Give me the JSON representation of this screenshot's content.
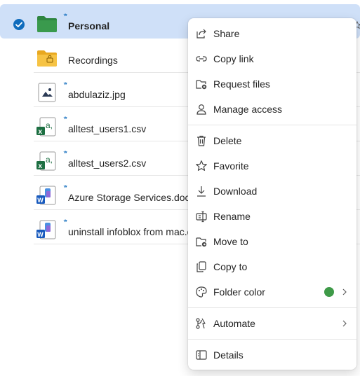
{
  "colors": {
    "selected_row_bg": "#cfe0f8",
    "accent": "#0f6cbd",
    "folder_green": "#2e8540",
    "folder_yellow": "#f6c344",
    "excel_green": "#1d6f42",
    "word_blue": "#185abd",
    "folder_color_swatch": "#3e9a48"
  },
  "files": [
    {
      "name": "Personal",
      "icon": "folder-green-icon",
      "selected": true
    },
    {
      "name": "Recordings",
      "icon": "folder-recordings-icon",
      "selected": false
    },
    {
      "name": "abdulaziz.jpg",
      "icon": "image-file-icon",
      "selected": false
    },
    {
      "name": "alltest_users1.csv",
      "icon": "excel-csv-icon",
      "selected": false
    },
    {
      "name": "alltest_users2.csv",
      "icon": "excel-csv-icon",
      "selected": false
    },
    {
      "name": "Azure Storage Services.docx",
      "icon": "word-doc-icon",
      "selected": false
    },
    {
      "name": "uninstall infoblox from mac.docx",
      "icon": "word-doc-icon",
      "selected": false
    }
  ],
  "context_menu": {
    "items": [
      {
        "label": "Share",
        "icon": "share-icon"
      },
      {
        "label": "Copy link",
        "icon": "link-icon"
      },
      {
        "label": "Request files",
        "icon": "request-files-icon"
      },
      {
        "label": "Manage access",
        "icon": "person-icon"
      },
      {
        "label": "Delete",
        "icon": "trash-icon"
      },
      {
        "label": "Favorite",
        "icon": "star-icon"
      },
      {
        "label": "Download",
        "icon": "download-icon"
      },
      {
        "label": "Rename",
        "icon": "rename-icon"
      },
      {
        "label": "Move to",
        "icon": "move-to-icon"
      },
      {
        "label": "Copy to",
        "icon": "copy-to-icon"
      },
      {
        "label": "Folder color",
        "icon": "palette-icon"
      },
      {
        "label": "Automate",
        "icon": "automate-icon"
      },
      {
        "label": "Details",
        "icon": "details-icon"
      }
    ]
  }
}
